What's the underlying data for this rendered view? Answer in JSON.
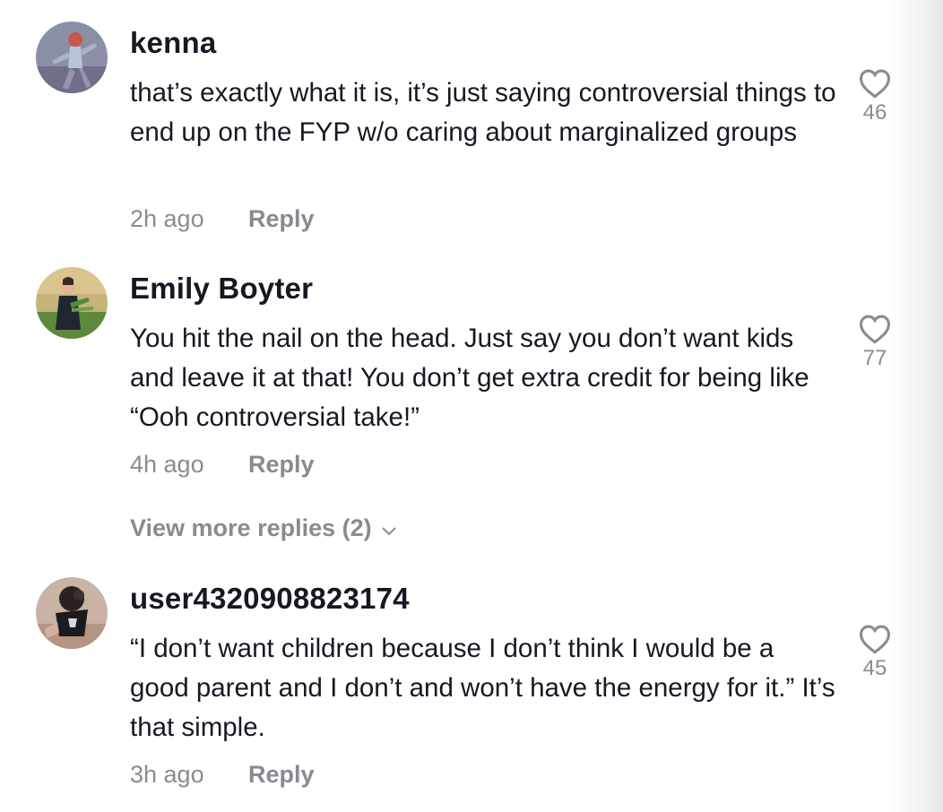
{
  "comments": [
    {
      "username": "kenna",
      "text": "that’s exactly what it is, it’s just saying controversial things to end up on the FYP w/o caring about marginalized groups",
      "time": "2h ago",
      "reply_label": "Reply",
      "likes": "46"
    },
    {
      "username": "Emily Boyter",
      "text": "You hit the nail on the head. Just say you don’t want kids and leave it at that! You don’t get extra credit for being like “Ooh controversial take!”",
      "time": "4h ago",
      "reply_label": "Reply",
      "likes": "77"
    },
    {
      "username": "user4320908823174",
      "text": "“I don’t want children because I don’t think I would be a good parent and I don’t and won’t have the energy for it.” It’s that simple.",
      "time": "3h ago",
      "reply_label": "Reply",
      "likes": "45"
    }
  ],
  "view_more_replies": "View more replies (2)",
  "colors": {
    "primary_text": "#161823",
    "secondary_text": "#8a8b91"
  },
  "icons": {
    "like": "heart-outline-icon",
    "expand": "chevron-down-icon"
  }
}
